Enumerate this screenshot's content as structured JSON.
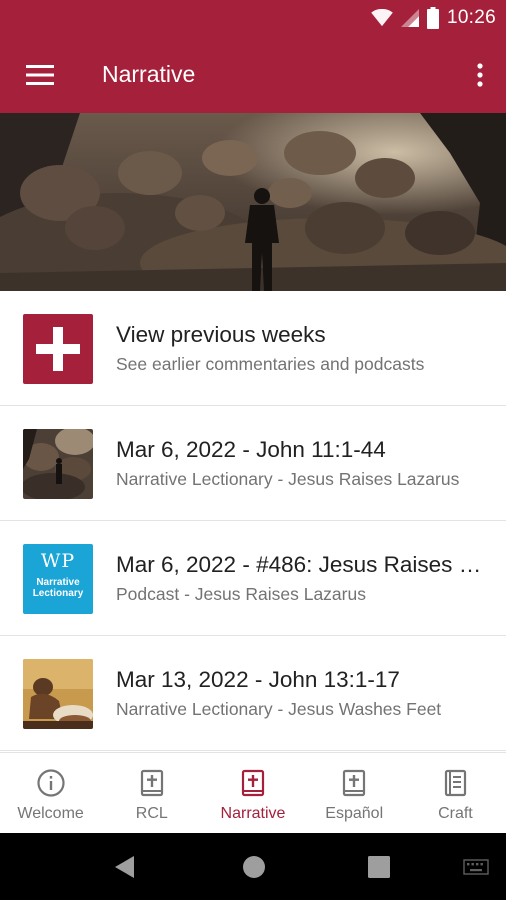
{
  "status_bar": {
    "time": "10:26",
    "icons": [
      "wifi-icon",
      "cellular-signal-icon",
      "battery-icon"
    ]
  },
  "app_bar": {
    "title": "Narrative",
    "menu_icon": "hamburger-menu-icon",
    "more_icon": "more-vert-icon",
    "color": "#a5203a"
  },
  "hero": {
    "image": "person-standing-in-rocky-cave-photo"
  },
  "list": [
    {
      "title": "View previous weeks",
      "subtitle": "See earlier commentaries and podcasts",
      "thumb": "plus-icon"
    },
    {
      "title": "Mar 6, 2022 - John 11:1-44",
      "subtitle": "Narrative Lectionary - Jesus Raises Lazarus",
      "thumb": "cave-photo-thumbnail"
    },
    {
      "title": "Mar 6, 2022 - #486: Jesus Raises Lazarus",
      "subtitle": "Podcast - Jesus Raises Lazarus",
      "thumb": "working-preacher-podcast-logo",
      "logo_letters": "WP",
      "logo_text": "Narrative Lectionary"
    },
    {
      "title": "Mar 13, 2022 - John 13:1-17",
      "subtitle": "Narrative Lectionary - Jesus Washes Feet",
      "thumb": "foot-washing-painting-thumbnail"
    }
  ],
  "bottom_nav": {
    "items": [
      {
        "label": "Welcome",
        "icon": "info-circle-icon"
      },
      {
        "label": "RCL",
        "icon": "bible-book-icon"
      },
      {
        "label": "Narrative",
        "icon": "bible-book-icon",
        "active": true
      },
      {
        "label": "Español",
        "icon": "bible-book-icon"
      },
      {
        "label": "Craft",
        "icon": "notebook-icon"
      }
    ],
    "active_color": "#a5203a",
    "inactive_color": "#757575"
  },
  "system_nav": {
    "buttons": [
      "back-icon",
      "home-icon",
      "recents-icon",
      "keyboard-icon"
    ]
  }
}
